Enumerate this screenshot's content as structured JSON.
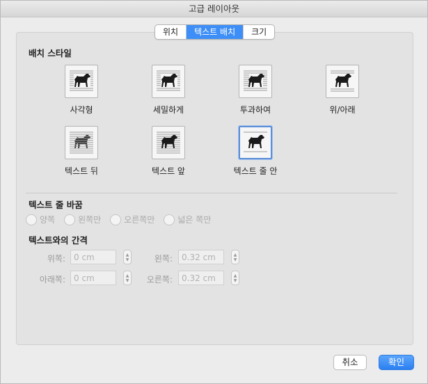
{
  "window": {
    "title": "고급 레이아웃"
  },
  "tabs": [
    {
      "label": "위치",
      "active": false
    },
    {
      "label": "텍스트 배치",
      "active": true
    },
    {
      "label": "크기",
      "active": false
    }
  ],
  "wrapping_style": {
    "title": "배치 스타일",
    "options": [
      {
        "label": "사각형",
        "icon": "dog-square-wrap-icon",
        "selected": false
      },
      {
        "label": "세밀하게",
        "icon": "dog-tight-wrap-icon",
        "selected": false
      },
      {
        "label": "투과하여",
        "icon": "dog-through-wrap-icon",
        "selected": false
      },
      {
        "label": "위/아래",
        "icon": "dog-top-bottom-wrap-icon",
        "selected": false
      },
      {
        "label": "텍스트 뒤",
        "icon": "dog-behind-text-icon",
        "selected": false
      },
      {
        "label": "텍스트 앞",
        "icon": "dog-in-front-text-icon",
        "selected": false
      },
      {
        "label": "텍스트 줄 안",
        "icon": "dog-inline-text-icon",
        "selected": true
      }
    ]
  },
  "wrap_text": {
    "title": "텍스트 줄 바꿈",
    "options": [
      "양쪽",
      "왼쪽만",
      "오른쪽만",
      "넓은 쪽만"
    ]
  },
  "distance": {
    "title": "텍스트와의 간격",
    "top_label": "위쪽:",
    "top_value": "0 cm",
    "bottom_label": "아래쪽:",
    "bottom_value": "0 cm",
    "left_label": "왼쪽:",
    "left_value": "0.32 cm",
    "right_label": "오른쪽:",
    "right_value": "0.32 cm"
  },
  "buttons": {
    "cancel": "취소",
    "ok": "확인"
  },
  "colors": {
    "accent": "#3d8ef7",
    "panel": "#e3e3e3"
  }
}
